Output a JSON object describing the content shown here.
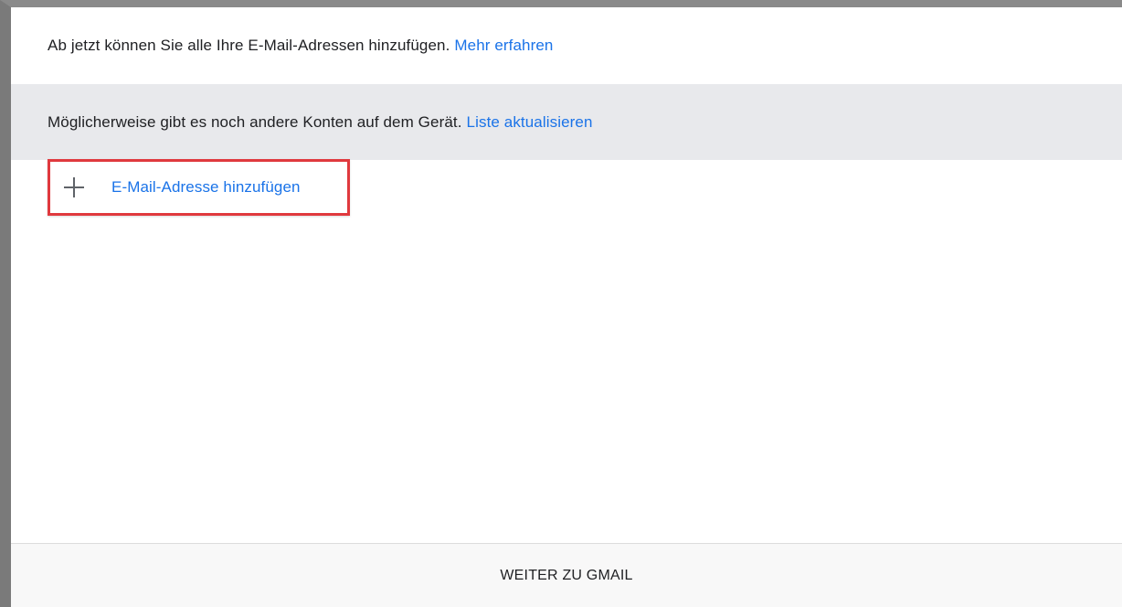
{
  "info": {
    "text": "Ab jetzt können Sie alle Ihre E-Mail-Adressen hinzufügen.",
    "link": "Mehr erfahren"
  },
  "notice": {
    "text": "Möglicherweise gibt es noch andere Konten auf dem Gerät.",
    "link": "Liste aktualisieren"
  },
  "add_email": {
    "icon": "plus-icon",
    "label": "E-Mail-Adresse hinzufügen"
  },
  "footer": {
    "button_label": "WEITER ZU GMAIL"
  },
  "colors": {
    "link": "#1a73e8",
    "notice_background": "#e8e9ec",
    "highlight_border": "#e0393e"
  }
}
